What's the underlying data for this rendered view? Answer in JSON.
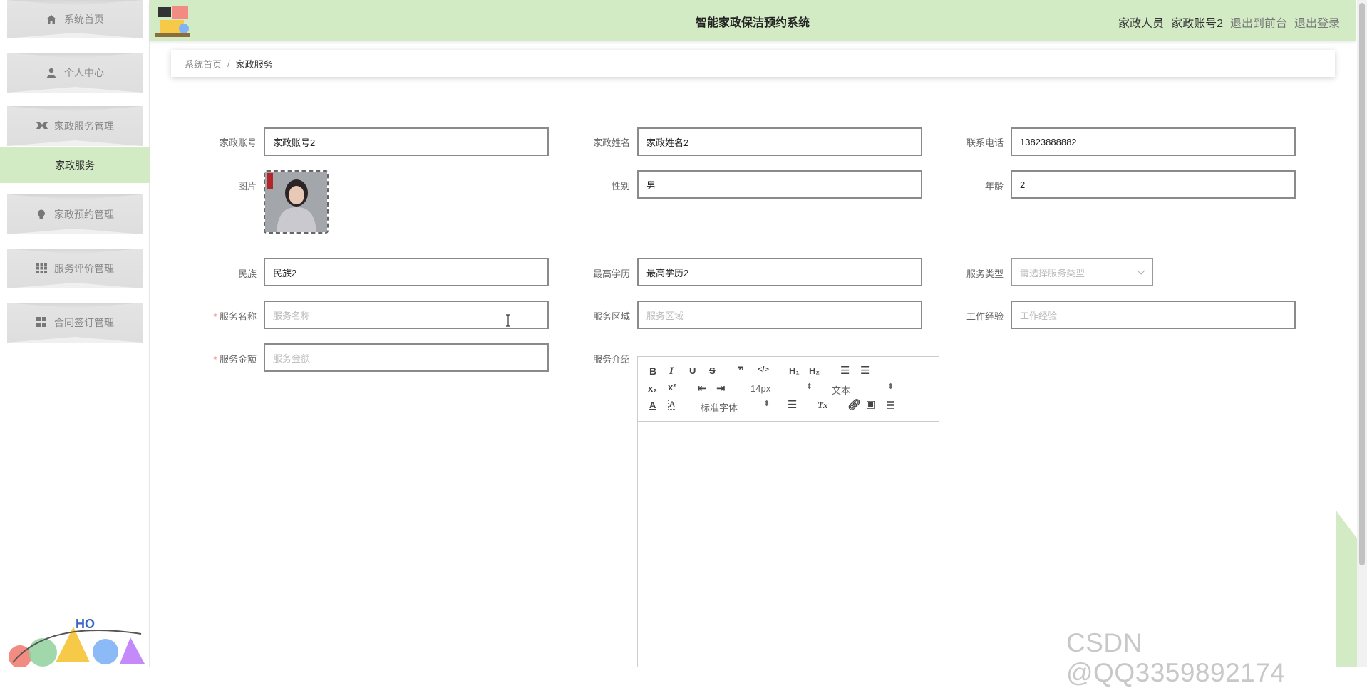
{
  "app": {
    "title": "智能家政保洁预约系统",
    "accent_color": "#d3ebc4"
  },
  "header": {
    "role": "家政人员",
    "user": "家政账号2",
    "front_link": "退出到前台",
    "logout_link": "退出登录"
  },
  "sidebar": {
    "items": [
      {
        "label": "系统首页",
        "icon": "home-icon"
      },
      {
        "label": "个人中心",
        "icon": "user-icon"
      },
      {
        "label": "家政服务管理",
        "icon": "service-icon"
      },
      {
        "label": "家政预约管理",
        "icon": "bulb-icon"
      },
      {
        "label": "服务评价管理",
        "icon": "grid-icon"
      },
      {
        "label": "合同签订管理",
        "icon": "apps-icon"
      }
    ],
    "active_sub": "家政服务"
  },
  "breadcrumb": {
    "home": "系统首页",
    "sep": "/",
    "current": "家政服务"
  },
  "form": {
    "account": {
      "label": "家政账号",
      "value": "家政账号2"
    },
    "name": {
      "label": "家政姓名",
      "value": "家政姓名2"
    },
    "phone": {
      "label": "联系电话",
      "value": "13823888882"
    },
    "photo": {
      "label": "图片"
    },
    "gender": {
      "label": "性别",
      "value": "男"
    },
    "age": {
      "label": "年龄",
      "value": "2"
    },
    "ethnicity": {
      "label": "民族",
      "value": "民族2"
    },
    "education": {
      "label": "最高学历",
      "value": "最高学历2"
    },
    "service_type": {
      "label": "服务类型",
      "placeholder": "请选择服务类型"
    },
    "service_name": {
      "label": "服务名称",
      "placeholder": "服务名称"
    },
    "service_area": {
      "label": "服务区域",
      "placeholder": "服务区域"
    },
    "experience": {
      "label": "工作经验",
      "placeholder": "工作经验"
    },
    "price": {
      "label": "服务金额",
      "placeholder": "服务金额"
    },
    "intro": {
      "label": "服务介绍"
    }
  },
  "editor": {
    "font_size": "14px",
    "block_type": "文本",
    "font_family": "标准字体"
  },
  "watermark": "CSDN @QQ3359892174"
}
